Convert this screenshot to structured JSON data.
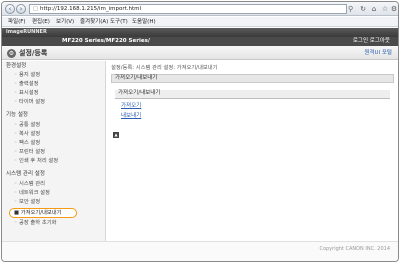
{
  "browser": {
    "url": "http://192.168.1.215/im_import.html",
    "menu": [
      "파일(F)",
      "편집(E)",
      "보기(V)",
      "즐겨찾기(A)",
      "도구(T)",
      "도움말(H)"
    ]
  },
  "header": {
    "logo": "imageRUNNER",
    "model": "MF220 Series/MF220 Series/",
    "login": "로그인 로그아웃",
    "title": "설정/등록",
    "portal_link": "원격UI 포털"
  },
  "sidebar": {
    "groups": [
      {
        "heading": "환경설정",
        "items": [
          "용지 설정",
          "출력설정",
          "표시설정",
          "타이머 설정"
        ]
      },
      {
        "heading": "기능 설정",
        "items": [
          "공통 설정",
          "복사 설정",
          "팩스 설정",
          "프린터 설정",
          "인쇄 후 처리 설정"
        ]
      },
      {
        "heading": "시스템 관리 설정",
        "items": [
          "시스템 관리",
          "네트워크 설정",
          "보안 설정"
        ]
      }
    ],
    "active_item": "가져오기/내보내기",
    "after_active": "공장 출하 초기화"
  },
  "main": {
    "breadcrumb": "설정/등록: 시스템 관리 설정: 가져오기/내보내기",
    "section_title": "가져오기/내보내기",
    "subsection_title": "가져오기/내보내기",
    "links": [
      "가져오기",
      "내보내기"
    ],
    "footer": "Copyright CANON INC. 2014"
  }
}
